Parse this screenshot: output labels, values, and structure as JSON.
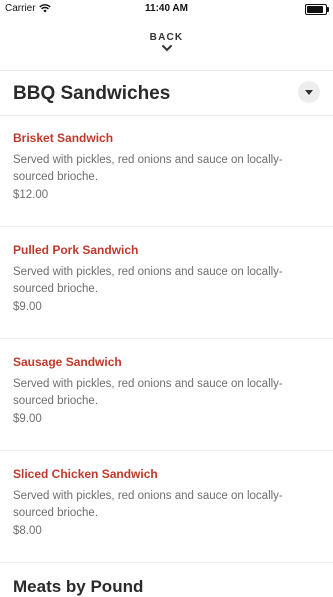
{
  "status_bar": {
    "carrier": "Carrier",
    "time": "11:40 AM",
    "battery_level": 1.0
  },
  "nav": {
    "back_label": "BACK"
  },
  "section": {
    "title": "BBQ Sandwiches"
  },
  "items": [
    {
      "name": "Brisket Sandwich",
      "description": "Served with pickles, red onions and sauce on locally-sourced brioche.",
      "price": "$12.00"
    },
    {
      "name": "Pulled Pork Sandwich",
      "description": "Served with pickles, red onions and sauce on locally-sourced brioche.",
      "price": "$9.00"
    },
    {
      "name": "Sausage Sandwich",
      "description": "Served with pickles, red onions and sauce on locally-sourced brioche.",
      "price": "$9.00"
    },
    {
      "name": "Sliced Chicken Sandwich",
      "description": "Served with pickles, red onions and sauce on locally-sourced brioche.",
      "price": "$8.00"
    }
  ],
  "next_section": {
    "title": "Meats by Pound"
  },
  "colors": {
    "item_name": "#c0392b",
    "text_muted": "#6f6f6f"
  }
}
